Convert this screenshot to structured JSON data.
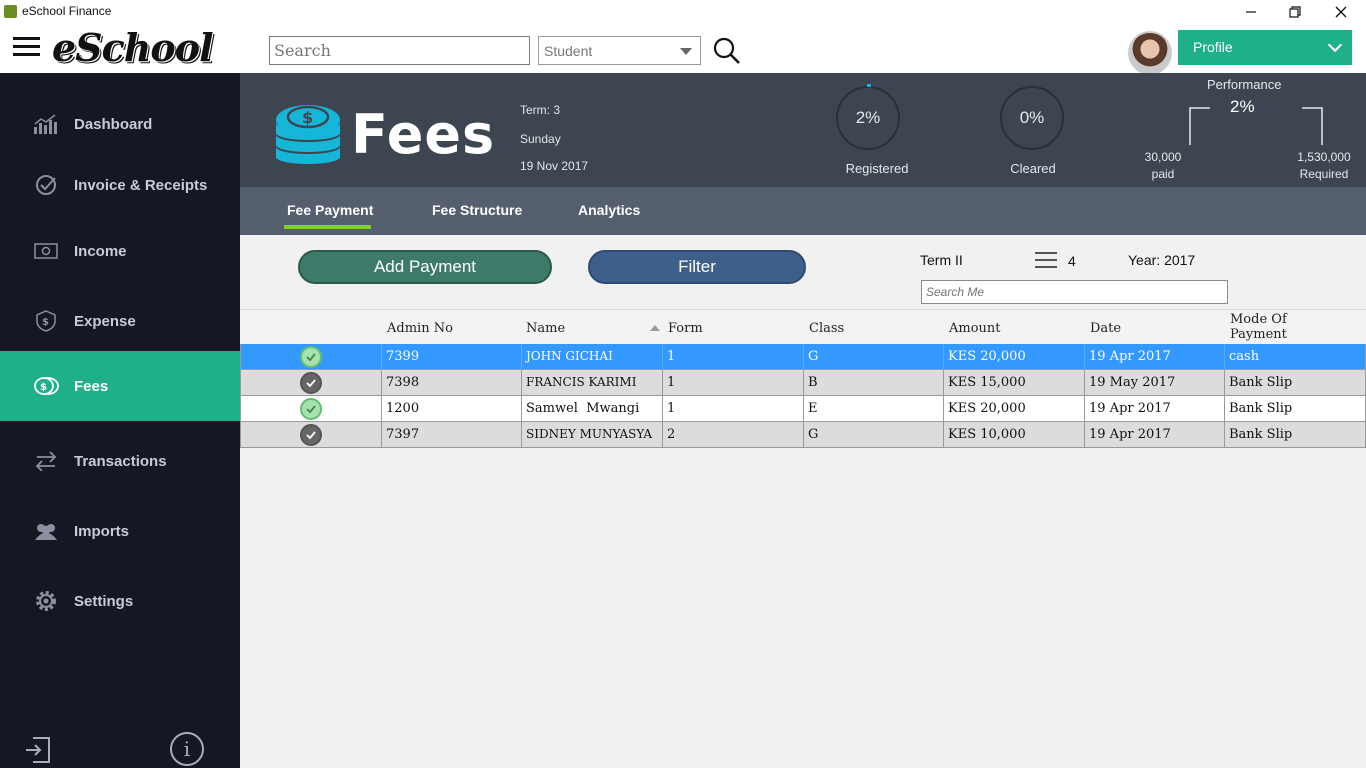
{
  "window": {
    "title": "eSchool Finance",
    "minimize": "—",
    "restore": "❐",
    "close": "✕"
  },
  "toolbar": {
    "logo": "eSchool",
    "search_placeholder": "Search",
    "student_select": "Student",
    "profile_label": "Profile"
  },
  "sidebar": {
    "items": [
      {
        "label": "Dashboard",
        "icon": "chart-icon"
      },
      {
        "label": "Invoice & Receipts",
        "icon": "check-circle-icon"
      },
      {
        "label": "Income",
        "icon": "money-icon"
      },
      {
        "label": "Expense",
        "icon": "expense-shield-icon"
      },
      {
        "label": "Fees",
        "icon": "coin-icon"
      },
      {
        "label": "Transactions",
        "icon": "transfer-arrows-icon"
      },
      {
        "label": "Imports",
        "icon": "users-icon"
      },
      {
        "label": "Settings",
        "icon": "gear-icon"
      }
    ],
    "active": "Fees",
    "info_symbol": "i"
  },
  "banner": {
    "title": "Fees",
    "term": "Term: 3",
    "day": "Sunday",
    "date": "19 Nov 2017",
    "registered_pct": "2%",
    "registered_label": "Registered",
    "cleared_pct": "0%",
    "cleared_label": "Cleared",
    "performance_title": "Performance",
    "performance_pct": "2%",
    "paid_amount": "30,000",
    "paid_label": "paid",
    "required_amount": "1,530,000",
    "required_label": "Required"
  },
  "tabs": [
    {
      "label": "Fee Payment",
      "active": true
    },
    {
      "label": "Fee Structure",
      "active": false
    },
    {
      "label": "Analytics",
      "active": false
    }
  ],
  "actions": {
    "add_payment": "Add Payment",
    "filter": "Filter",
    "term": "Term II",
    "count": "4",
    "year": "Year: 2017",
    "search_placeholder": "Search Me"
  },
  "table": {
    "columns": [
      "Admin No",
      "Name",
      "Form",
      "Class",
      "Amount",
      "Date",
      "Mode Of Payment"
    ],
    "rows": [
      {
        "status": "cleared",
        "admin_no": "7399",
        "name": "JOHN GICHAI",
        "form": "1",
        "class": "G",
        "amount": "KES 20,000",
        "date": "19 Apr 2017",
        "mode": "cash"
      },
      {
        "status": "pending",
        "admin_no": "7398",
        "name": "FRANCIS KARIMI",
        "form": "1",
        "class": "B",
        "amount": "KES 15,000",
        "date": "19 May 2017",
        "mode": "Bank Slip"
      },
      {
        "status": "cleared",
        "admin_no": "1200",
        "name": "Samwel  Mwangi",
        "form": "1",
        "class": "E",
        "amount": "KES 20,000",
        "date": "19 Apr 2017",
        "mode": "Bank Slip"
      },
      {
        "status": "pending",
        "admin_no": "7397",
        "name": "SIDNEY MUNYASYA",
        "form": "2",
        "class": "G",
        "amount": "KES 10,000",
        "date": "19 Apr 2017",
        "mode": "Bank Slip"
      }
    ],
    "selected_row": 0
  },
  "colors": {
    "sidebar_bg": "#151823",
    "accent_green": "#1fb08a",
    "banner_bg": "#3d4650",
    "tab_bar_bg": "#555f6d",
    "selected_row": "#3399ff",
    "tab_underline": "#7ed321"
  }
}
